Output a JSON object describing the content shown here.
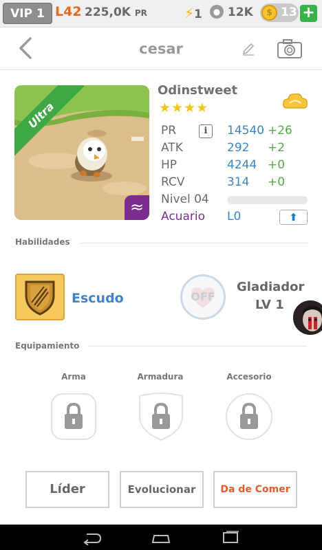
{
  "topbar": {
    "vip": "VIP 1",
    "level": "L42",
    "pr_value": "225,0K",
    "pr_suffix": "PR",
    "energy": "1",
    "paws": "12K",
    "coins": "13",
    "plus": "+"
  },
  "header": {
    "title": "cesar",
    "back_icon": "chevron-left-icon",
    "edit_icon": "pencil-icon",
    "camera_icon": "camera-icon"
  },
  "pet": {
    "name": "Odinstweet",
    "rarity": "Ultra",
    "stars": "★★★★",
    "star_count": 4,
    "element_glyph": "≈",
    "stats": [
      {
        "label": "PR",
        "value": "14540",
        "bonus": "+26"
      },
      {
        "label": "ATK",
        "value": "292",
        "bonus": "+2"
      },
      {
        "label": "HP",
        "value": "4244",
        "bonus": "+0"
      },
      {
        "label": "RCV",
        "value": "314",
        "bonus": "+0"
      }
    ],
    "info_glyph": "i",
    "level_label": "Nivel 04",
    "level_progress": 0,
    "element_label": "Acuario",
    "element_value": "L0",
    "upgrade_glyph": "⬆"
  },
  "skills": {
    "header": "Habilidades",
    "skill_name": "Escudo",
    "off_label": "OFF",
    "leader_skill": "Gladiador",
    "leader_level": "LV 1"
  },
  "equipment": {
    "header": "Equipamiento",
    "slots": [
      {
        "label": "Arma"
      },
      {
        "label": "Armadura"
      },
      {
        "label": "Accesorio"
      }
    ]
  },
  "actions": {
    "leader": "Líder",
    "evolve": "Evolucionar",
    "feed": "Da de Comer"
  },
  "colors": {
    "accent_blue": "#3c84c6",
    "bonus_green": "#58a84a",
    "feed_red": "#e25b2a",
    "element_purple": "#7a2c8f"
  }
}
